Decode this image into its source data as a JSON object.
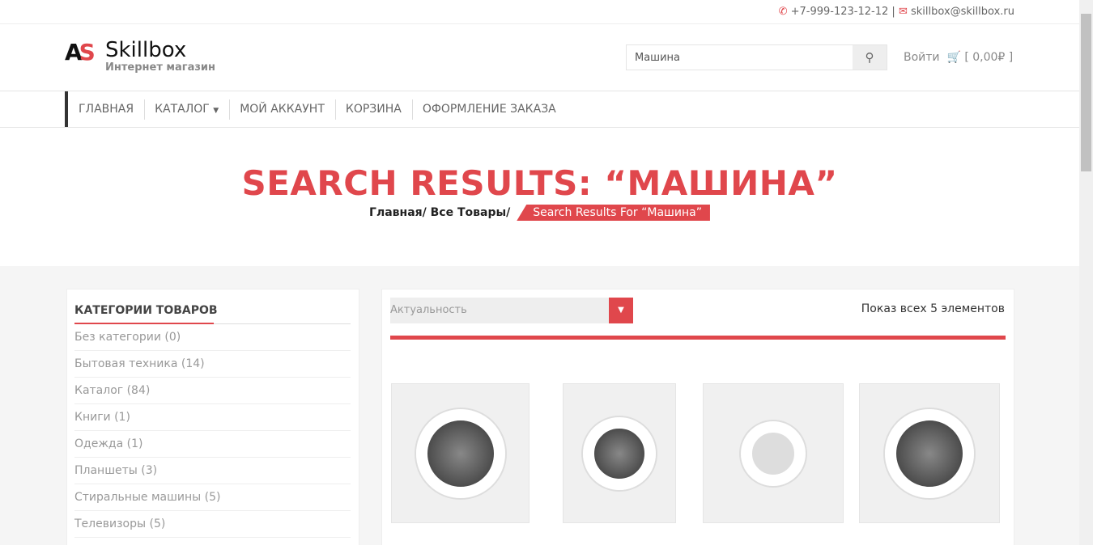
{
  "topbar": {
    "phone": "+7-999-123-12-12",
    "separator": "|",
    "email": "skillbox@skillbox.ru"
  },
  "logo": {
    "mark": "AS",
    "title": "Skillbox",
    "subtitle": "Интернет магазин"
  },
  "search": {
    "value": "Машина",
    "icon": "search-icon"
  },
  "header": {
    "login": "Войти",
    "cart": "[ 0,00₽ ]"
  },
  "nav": [
    "ГЛАВНАЯ",
    "КАТАЛОГ",
    "МОЙ АККАУНТ",
    "КОРЗИНА",
    "ОФОРМЛЕНИЕ ЗАКАЗА"
  ],
  "hero": {
    "title": "SEARCH RESULTS: “МАШИНА”",
    "crumbs": [
      "Главная",
      "Все Товары"
    ],
    "current": "Search Results For “Машина”"
  },
  "sidebar": {
    "title": "КАТЕГОРИИ ТОВАРОВ",
    "items": [
      "Без категории (0)",
      "Бытовая техника (14)",
      "Каталог (84)",
      "Книги (1)",
      "Одежда (1)",
      "Планшеты (3)",
      "Стиральные машины (5)",
      "Телевизоры (5)"
    ]
  },
  "content": {
    "sort": "Актуальность",
    "count": "Показ всех 5 элементов"
  },
  "colors": {
    "accent": "#e0474c"
  }
}
